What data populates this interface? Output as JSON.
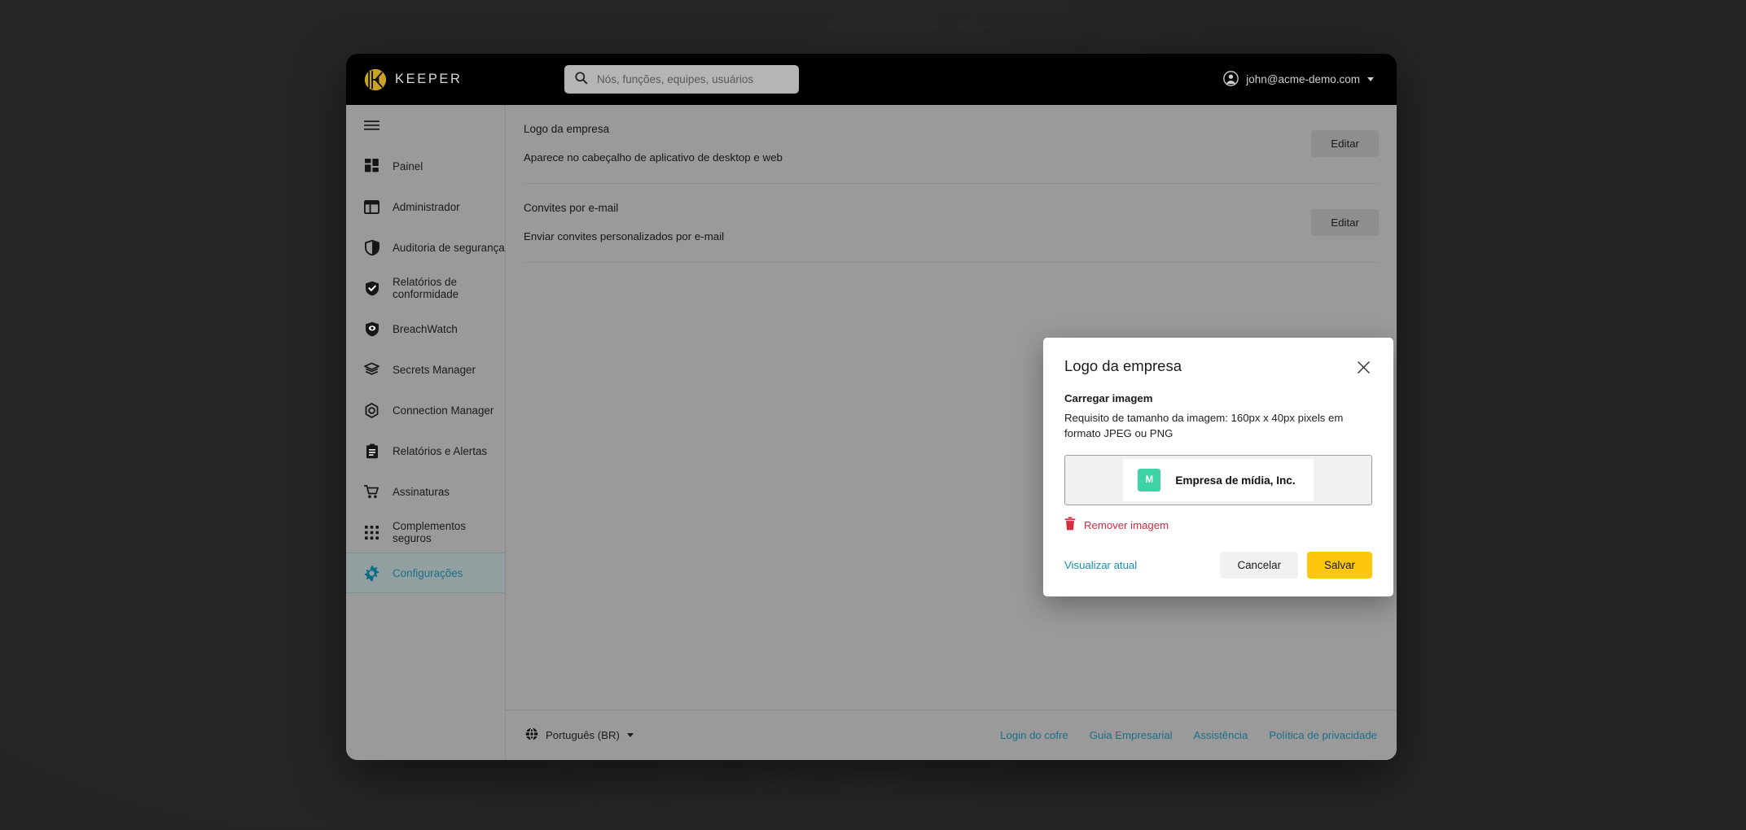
{
  "colors": {
    "brand_yellow": "#c9a227",
    "accent_teal": "#1a6f86",
    "link_blue": "#1a8fae",
    "danger_red": "#d22d3f",
    "save_yellow": "#fcc70d",
    "logo_tile_green": "#3ed2a7",
    "app_bg": "#9a9a9a",
    "topbar_bg": "#000000"
  },
  "topbar": {
    "brand_name": "KEEPER",
    "brand_icon": "keeper-logo-icon",
    "search": {
      "icon": "search-icon",
      "placeholder": "Nós, funções, equipes, usuários",
      "value": ""
    },
    "account": {
      "icon": "user-avatar-icon",
      "email": "john@acme-demo.com",
      "caret_icon": "chevron-down-icon"
    }
  },
  "sidebar": {
    "toggle_icon": "hamburger-menu-icon",
    "items": [
      {
        "label": "Painel",
        "icon": "dashboard-icon",
        "active": false
      },
      {
        "label": "Administrador",
        "icon": "admin-panel-icon",
        "active": false
      },
      {
        "label": "Auditoria de segurança",
        "icon": "shield-half-icon",
        "active": false
      },
      {
        "label": "Relatórios de conformidade",
        "icon": "shield-check-icon",
        "active": false
      },
      {
        "label": "BreachWatch",
        "icon": "shield-eye-icon",
        "active": false
      },
      {
        "label": "Secrets Manager",
        "icon": "layers-icon",
        "active": false
      },
      {
        "label": "Connection Manager",
        "icon": "hexagon-node-icon",
        "active": false
      },
      {
        "label": "Relatórios e Alertas",
        "icon": "clipboard-icon",
        "active": false
      },
      {
        "label": "Assinaturas",
        "icon": "shopping-cart-icon",
        "active": false
      },
      {
        "label": "Complementos seguros",
        "icon": "grid-dots-icon",
        "active": false
      },
      {
        "label": "Configurações",
        "icon": "gear-icon",
        "active": true
      }
    ]
  },
  "main": {
    "rows": [
      {
        "title": "Logo da empresa",
        "description": "Aparece no cabeçalho de aplicativo de desktop e web",
        "action_label": "Editar"
      },
      {
        "title": "Convites por e-mail",
        "description": "Enviar convites personalizados por e-mail",
        "action_label": "Editar"
      }
    ]
  },
  "footer": {
    "language": {
      "icon": "globe-icon",
      "label": "Português (BR)",
      "caret_icon": "chevron-down-icon"
    },
    "links": [
      {
        "label": "Login do cofre"
      },
      {
        "label": "Guia Empresarial"
      },
      {
        "label": "Assistência"
      },
      {
        "label": "Política de privacidade"
      }
    ]
  },
  "modal": {
    "title": "Logo da empresa",
    "close_icon": "close-icon",
    "upload_heading": "Carregar imagem",
    "requirement_text": "Requisito de tamanho da imagem: 160px x 40px pixels em formato JPEG ou PNG",
    "preview": {
      "tile_letter": "M",
      "company_name": "Empresa de mídia, Inc."
    },
    "remove": {
      "icon": "trash-icon",
      "label": "Remover imagem"
    },
    "preview_link": "Visualizar atual",
    "cancel_label": "Cancelar",
    "save_label": "Salvar"
  }
}
